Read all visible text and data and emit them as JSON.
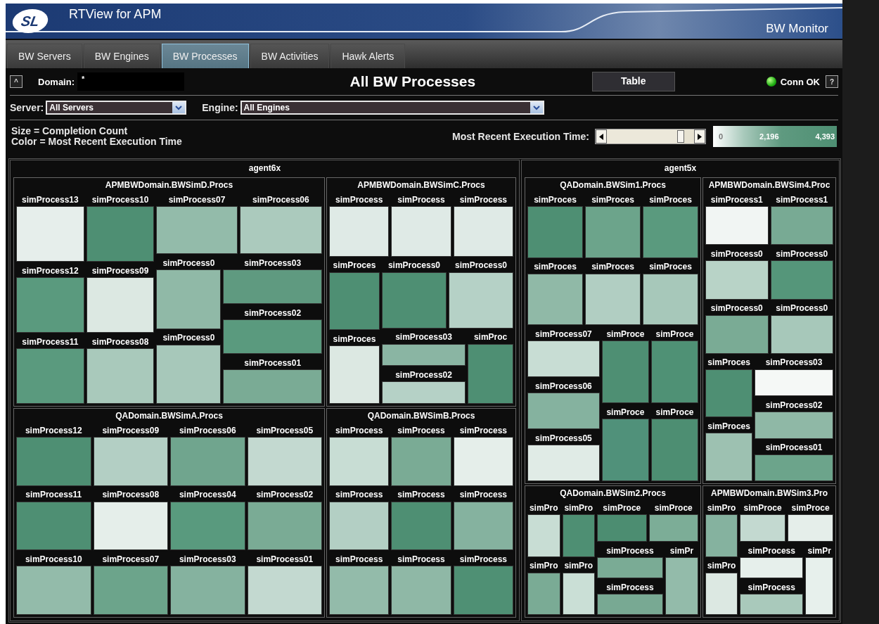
{
  "app": {
    "logo": "SL",
    "title": "RTView for APM",
    "subtitle": "BW Monitor"
  },
  "tabs": [
    {
      "label": "BW Servers",
      "selected": false
    },
    {
      "label": "BW Engines",
      "selected": false
    },
    {
      "label": "BW Processes",
      "selected": true
    },
    {
      "label": "BW Activities",
      "selected": false
    },
    {
      "label": "Hawk Alerts",
      "selected": false
    }
  ],
  "toolbar": {
    "collapse_button": "^",
    "domain_label": "Domain:",
    "domain_value": "*",
    "page_title": "All BW Processes",
    "table_button": "Table",
    "connection": {
      "label": "Conn OK",
      "connected": true
    },
    "help_button": "?"
  },
  "filters": [
    {
      "label": "Server:",
      "value": "All Servers"
    },
    {
      "label": "Engine:",
      "value": "All Engines"
    }
  ],
  "legend": {
    "size_text": "Size = Completion Count",
    "color_text": "Color = Most Recent Execution Time",
    "slider_label": "Most Recent Execution Time:",
    "scale_labels": [
      "0",
      "2,196",
      "4,393"
    ]
  },
  "treemap": {
    "agents": [
      {
        "name": "agent6x",
        "domains": [
          {
            "name": "APMBWDomain.BWSimD.Procs",
            "processes": [
              {
                "label": "simProcess13",
                "color": "#e6eeeb"
              },
              {
                "label": "simProcess10",
                "color": "#4e8f73"
              },
              {
                "label": "simProcess12",
                "color": "#5a9a7e"
              },
              {
                "label": "simProcess09",
                "color": "#dce8e2"
              },
              {
                "label": "simProcess11",
                "color": "#5a9a7e"
              },
              {
                "label": "simProcess08",
                "color": "#a9c9bb"
              },
              {
                "label": "simProcess07",
                "color": "#93bbaa"
              },
              {
                "label": "simProcess06",
                "color": "#abcabd"
              },
              {
                "label": "simProcess0",
                "color": "#90b9a7"
              },
              {
                "label": "simProcess0",
                "color": "#a7c8ba"
              },
              {
                "label": "simProcess03",
                "color": "#5f9a80"
              },
              {
                "label": "simProcess02",
                "color": "#5a9a7e"
              },
              {
                "label": "simProcess01",
                "color": "#7aab95"
              }
            ]
          },
          {
            "name": "APMBWDomain.BWSimC.Procs",
            "processes": [
              {
                "label": "simProcess",
                "color": "#dfeae6"
              },
              {
                "label": "simProcess",
                "color": "#dfeae6"
              },
              {
                "label": "simProcess",
                "color": "#dfeae6"
              },
              {
                "label": "simProces",
                "color": "#4e8f73"
              },
              {
                "label": "simProces",
                "color": "#dce8e2"
              },
              {
                "label": "simProcess0",
                "color": "#4e8f73"
              },
              {
                "label": "simProcess0",
                "color": "#b5d1c6"
              },
              {
                "label": "simProcess03",
                "color": "#8ab5a3"
              },
              {
                "label": "simProcess02",
                "color": "#b5d1c6"
              },
              {
                "label": "simProc",
                "color": "#4e8f73"
              }
            ]
          },
          {
            "name": "QADomain.BWSimA.Procs",
            "processes": [
              {
                "label": "simProcess12",
                "color": "#4e8f73"
              },
              {
                "label": "simProcess09",
                "color": "#b3cfc4"
              },
              {
                "label": "simProcess06",
                "color": "#70a58e"
              },
              {
                "label": "simProcess05",
                "color": "#c3d9d0"
              },
              {
                "label": "simProcess11",
                "color": "#4e8f73"
              },
              {
                "label": "simProcess08",
                "color": "#e5eeea"
              },
              {
                "label": "simProcess04",
                "color": "#599a7e"
              },
              {
                "label": "simProcess02",
                "color": "#7aab95"
              },
              {
                "label": "simProcess10",
                "color": "#93bbaa"
              },
              {
                "label": "simProcess07",
                "color": "#6ca48b"
              },
              {
                "label": "simProcess03",
                "color": "#85b29f"
              },
              {
                "label": "simProcess01",
                "color": "#c3d9d0"
              }
            ]
          },
          {
            "name": "QADomain.BWSimB.Procs",
            "processes": [
              {
                "label": "simProcess",
                "color": "#c8ddd4"
              },
              {
                "label": "simProcess",
                "color": "#7aab95"
              },
              {
                "label": "simProcess",
                "color": "#e5eeea"
              },
              {
                "label": "simProcess",
                "color": "#b3cfc4"
              },
              {
                "label": "simProcess",
                "color": "#4e8f73"
              },
              {
                "label": "simProcess",
                "color": "#85b29f"
              },
              {
                "label": "simProcess",
                "color": "#93bbaa"
              },
              {
                "label": "simProcess",
                "color": "#8fb8a6"
              },
              {
                "label": "simProcess",
                "color": "#4f9074"
              }
            ]
          }
        ]
      },
      {
        "name": "agent5x",
        "domains": [
          {
            "name": "QADomain.BWSim1.Procs",
            "processes": [
              {
                "label": "simProces",
                "color": "#4e8f73"
              },
              {
                "label": "simProces",
                "color": "#6ca48b"
              },
              {
                "label": "simProces",
                "color": "#5a9a7e"
              },
              {
                "label": "simProces",
                "color": "#90b9a7"
              },
              {
                "label": "simProces",
                "color": "#b1cec2"
              },
              {
                "label": "simProces",
                "color": "#a7c8ba"
              },
              {
                "label": "simProcess07",
                "color": "#c8ddd4"
              },
              {
                "label": "simProcess06",
                "color": "#85b29f"
              },
              {
                "label": "simProcess05",
                "color": "#e0ebe6"
              },
              {
                "label": "simProce",
                "color": "#4e8f73"
              },
              {
                "label": "simProce",
                "color": "#4f9175"
              },
              {
                "label": "simProce",
                "color": "#50917a"
              },
              {
                "label": "simProce",
                "color": "#4d8e72"
              }
            ]
          },
          {
            "name": "APMBWDomain.BWSim4.Proc",
            "processes": [
              {
                "label": "simProcess1",
                "color": "#f1f5f3"
              },
              {
                "label": "simProcess1",
                "color": "#78aa94"
              },
              {
                "label": "simProcess0",
                "color": "#b8d3c7"
              },
              {
                "label": "simProcess0",
                "color": "#55967a"
              },
              {
                "label": "simProcess0",
                "color": "#7aab95"
              },
              {
                "label": "simProcess0",
                "color": "#a7c8ba"
              },
              {
                "label": "simProces",
                "color": "#4e8f73"
              },
              {
                "label": "simProces",
                "color": "#9dc1b1"
              },
              {
                "label": "simProcess03",
                "color": "#f5f8f6"
              },
              {
                "label": "simProcess02",
                "color": "#8fb8a6"
              },
              {
                "label": "simProcess01",
                "color": "#6ca48b"
              }
            ]
          },
          {
            "name": "QADomain.BWSim2.Procs",
            "processes": [
              {
                "label": "simPro",
                "color": "#c8ddd4"
              },
              {
                "label": "simPro",
                "color": "#4e8f73"
              },
              {
                "label": "simPro",
                "color": "#7aab95"
              },
              {
                "label": "simPro",
                "color": "#cadfd6"
              },
              {
                "label": "simProce",
                "color": "#4c8d71"
              },
              {
                "label": "simProce",
                "color": "#7cad97"
              },
              {
                "label": "simProcess",
                "color": "#7aab95"
              },
              {
                "label": "simProcess",
                "color": "#78a993"
              },
              {
                "label": "simPr",
                "color": "#93bbaa"
              }
            ]
          },
          {
            "name": "APMBWDomain.BWSim3.Pro",
            "processes": [
              {
                "label": "simPro",
                "color": "#85b29f"
              },
              {
                "label": "simPro",
                "color": "#dce8e2"
              },
              {
                "label": "simProce",
                "color": "#c3d9d0"
              },
              {
                "label": "simProce",
                "color": "#e5eeea"
              },
              {
                "label": "simProcess",
                "color": "#e6efeb"
              },
              {
                "label": "simProcess",
                "color": "#a9c9bb"
              },
              {
                "label": "simPr",
                "color": "#e7f0ec"
              }
            ]
          }
        ]
      }
    ]
  }
}
